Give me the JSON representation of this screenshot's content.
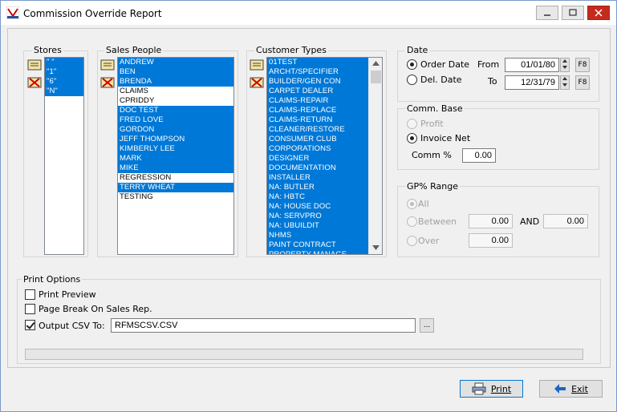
{
  "window": {
    "title": "Commission Override Report"
  },
  "stores": {
    "label": "Stores",
    "items": [
      "\" \"",
      "\"1\"",
      "\"6\"",
      "\"N\""
    ]
  },
  "sales_people": {
    "label": "Sales People",
    "items": [
      {
        "name": "ANDREW",
        "selected": true
      },
      {
        "name": "BEN",
        "selected": true
      },
      {
        "name": "BRENDA",
        "selected": true
      },
      {
        "name": "CLAIMS",
        "selected": false
      },
      {
        "name": "CPRIDDY",
        "selected": false
      },
      {
        "name": "DOC TEST",
        "selected": true
      },
      {
        "name": "FRED LOVE",
        "selected": true
      },
      {
        "name": "GORDON",
        "selected": true
      },
      {
        "name": "JEFF THOMPSON",
        "selected": true
      },
      {
        "name": "KIMBERLY LEE",
        "selected": true
      },
      {
        "name": "MARK",
        "selected": true
      },
      {
        "name": "MIKE",
        "selected": true
      },
      {
        "name": "REGRESSION",
        "selected": false
      },
      {
        "name": "TERRY WHEAT",
        "selected": true
      },
      {
        "name": "TESTING",
        "selected": false
      }
    ]
  },
  "customer_types": {
    "label": "Customer Types",
    "items": [
      "01TEST",
      "ARCHT/SPECIFIER",
      "BUILDER/GEN CON",
      "CARPET DEALER",
      "CLAIMS-REPAIR",
      "CLAIMS-REPLACE",
      "CLAIMS-RETURN",
      "CLEANER/RESTORE",
      "CONSUMER CLUB",
      "CORPORATIONS",
      "DESIGNER",
      "DOCUMENTATION",
      "INSTALLER",
      "NA: BUTLER",
      "NA: HBTC",
      "NA: HOUSE DOC",
      "NA: SERVPRO",
      "NA: UBUILDIT",
      "NHMS",
      "PAINT CONTRACT",
      "PROPERTY MANAGE"
    ]
  },
  "date": {
    "label": "Date",
    "order_date": "Order Date",
    "del_date": "Del. Date",
    "from_label": "From",
    "to_label": "To",
    "from_value": "01/01/80",
    "to_value": "12/31/79",
    "f8": "F8",
    "selected": "order_date"
  },
  "comm_base": {
    "label": "Comm. Base",
    "profit": "Profit",
    "invoice_net": "Invoice Net",
    "comm_pct_label": "Comm %",
    "comm_pct_value": "0.00",
    "selected": "invoice_net"
  },
  "gp_range": {
    "label": "GP% Range",
    "all": "All",
    "between": "Between",
    "over": "Over",
    "and": "AND",
    "between_from": "0.00",
    "between_to": "0.00",
    "over_value": "0.00",
    "selected": "all"
  },
  "print_options": {
    "label": "Print Options",
    "print_preview": "Print Preview",
    "page_break": "Page Break On Sales Rep.",
    "output_csv": "Output CSV To:",
    "csv_file": "RFMSCSV.CSV",
    "browse": "...",
    "print_preview_checked": false,
    "page_break_checked": false,
    "output_csv_checked": true
  },
  "buttons": {
    "print": "Print",
    "exit": "Exit"
  },
  "colors": {
    "selection": "#0078d7",
    "close": "#c42b1c"
  }
}
